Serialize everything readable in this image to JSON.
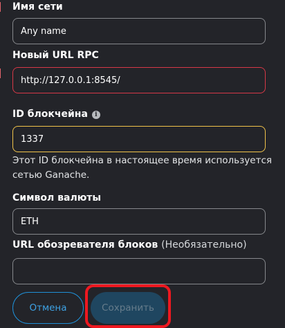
{
  "form": {
    "network_name": {
      "label": "Имя сети",
      "value": "Any name"
    },
    "rpc_url": {
      "label": "Новый URL RPC",
      "value": "http://127.0.0.1:8545/"
    },
    "chain_id": {
      "label": "ID блокчейна",
      "icon": "info-icon",
      "value": "1337",
      "hint": "Этот ID блокчейна в настоящее время используется сетью Ganache."
    },
    "currency_symbol": {
      "label": "Символ валюты",
      "value": "ETH"
    },
    "block_explorer": {
      "label": "URL обозревателя блоков",
      "optional_note": "(Необязательно)",
      "value": ""
    }
  },
  "buttons": {
    "cancel_label": "Отмена",
    "save_label": "Сохранить"
  },
  "colors": {
    "background": "#232429",
    "error_border": "#d73847",
    "warning_border": "#f0c34a",
    "primary_blue": "#1f8fd6",
    "disabled_button": "#1f4660",
    "annotation_highlight": "#ee1820"
  }
}
